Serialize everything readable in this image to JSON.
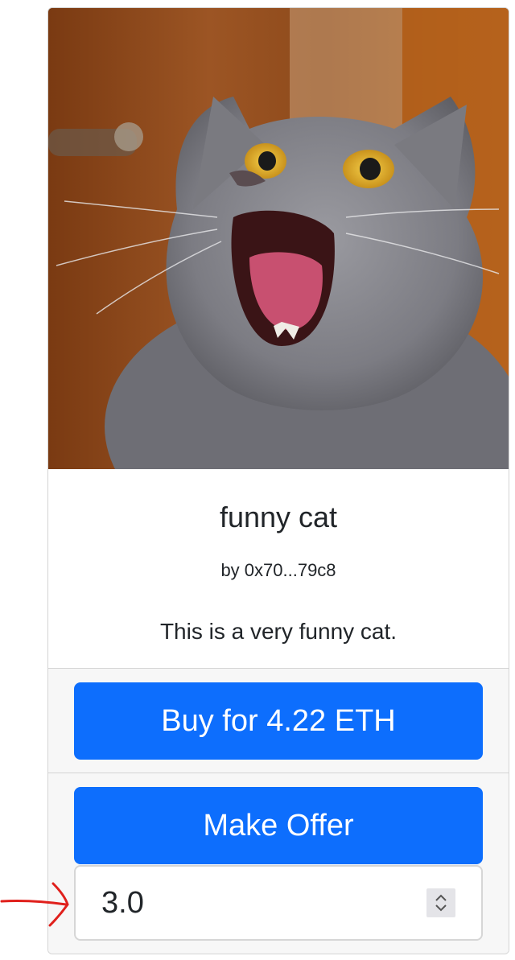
{
  "nft": {
    "image_alt": "Gray cat with mouth wide open",
    "title": "funny cat",
    "owner": "by 0x70...79c8",
    "description": "This is a very funny cat."
  },
  "actions": {
    "buy_label": "Buy for 4.22 ETH",
    "offer_label": "Make Offer",
    "offer_value": "3.0"
  },
  "colors": {
    "primary": "#0d6efd",
    "annotation": "#e0201c"
  },
  "icons": {
    "spinner": "number-spinner-icon",
    "annotation": "red-arrow-icon"
  }
}
